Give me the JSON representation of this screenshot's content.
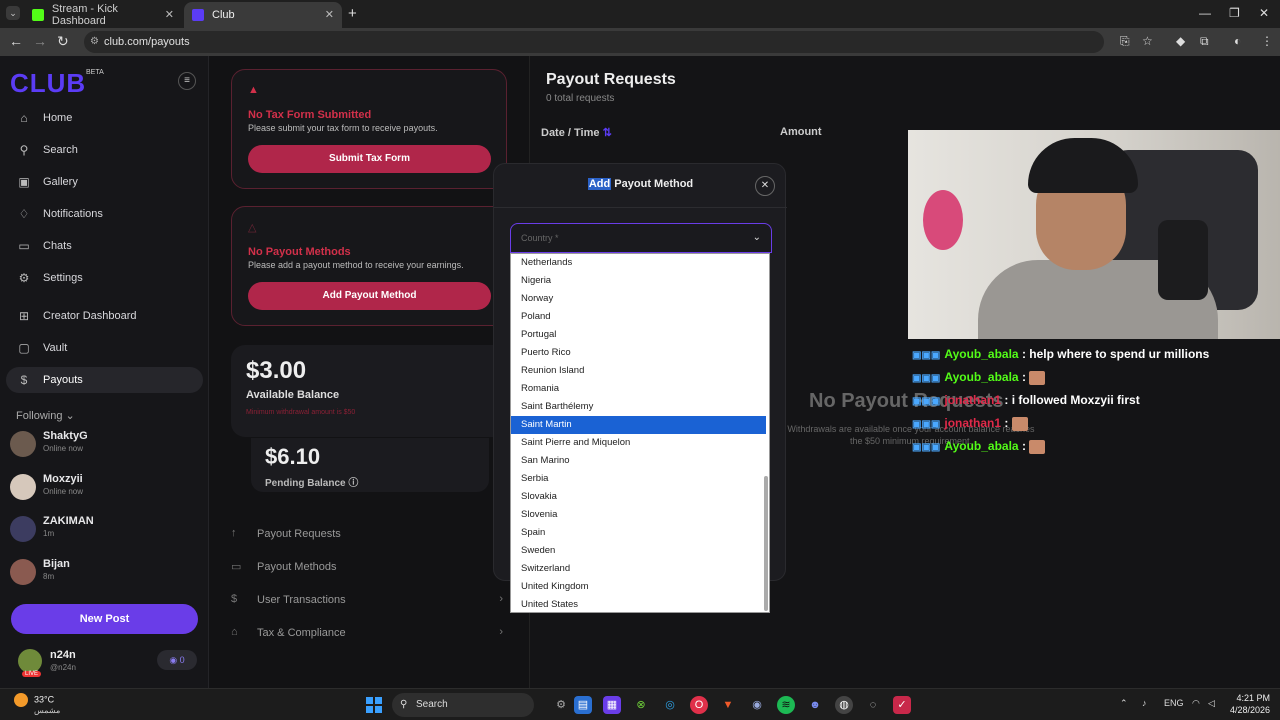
{
  "browser": {
    "tabs": [
      {
        "label": "Stream - Kick Dashboard"
      },
      {
        "label": "Club"
      }
    ],
    "url": "club.com/payouts"
  },
  "sidebar": {
    "logo": "CLUB",
    "logo_badge": "BETA",
    "nav": [
      {
        "label": "Home",
        "icon": "home-icon"
      },
      {
        "label": "Search",
        "icon": "search-icon"
      },
      {
        "label": "Gallery",
        "icon": "gallery-icon"
      },
      {
        "label": "Notifications",
        "icon": "bell-icon"
      },
      {
        "label": "Chats",
        "icon": "chat-icon"
      },
      {
        "label": "Settings",
        "icon": "gear-icon"
      },
      {
        "label": "Creator Dashboard",
        "icon": "dashboard-icon"
      },
      {
        "label": "Vault",
        "icon": "vault-icon"
      },
      {
        "label": "Payouts",
        "icon": "dollar-icon"
      }
    ],
    "following_label": "Following",
    "following": [
      {
        "name": "ShaktyG",
        "status": "Online now"
      },
      {
        "name": "Moxzyii",
        "status": "Online now"
      },
      {
        "name": "ZAKIMAN",
        "status": "1m"
      },
      {
        "name": "Bijan",
        "status": "8m"
      }
    ],
    "new_post": "New Post",
    "user": {
      "name": "n24n",
      "handle": "@n24n",
      "live": "LIVE",
      "coins": "0"
    }
  },
  "payouts": {
    "tax_card": {
      "title": "No Tax Form Submitted",
      "desc": "Please submit your tax form to receive payouts.",
      "button": "Submit Tax Form"
    },
    "method_card": {
      "title": "No Payout Methods",
      "desc": "Please add a payout method to receive your earnings.",
      "button": "Add Payout Method"
    },
    "available": {
      "amount": "$3.00",
      "label": "Available Balance",
      "note": "Minimum withdrawal amount is $50"
    },
    "pending": {
      "amount": "$6.10",
      "label": "Pending Balance"
    },
    "sub_nav": [
      {
        "label": "Payout Requests"
      },
      {
        "label": "Payout Methods"
      },
      {
        "label": "User Transactions"
      },
      {
        "label": "Tax & Compliance"
      }
    ]
  },
  "requests": {
    "title": "Payout Requests",
    "count": "0 total requests",
    "columns": {
      "date": "Date / Time",
      "amount": "Amount"
    },
    "empty_title": "No Payout Requests",
    "empty_desc": "Withdrawals are available once your account balance reaches the $50 minimum requirement."
  },
  "modal": {
    "title_highlight": "Add",
    "title_rest": " Payout Method",
    "select_placeholder": "Country *",
    "options": [
      "Netherlands",
      "Nigeria",
      "Norway",
      "Poland",
      "Portugal",
      "Puerto Rico",
      "Reunion Island",
      "Romania",
      "Saint Barthélemy",
      "Saint Martin",
      "Saint Pierre and Miquelon",
      "San Marino",
      "Serbia",
      "Slovakia",
      "Slovenia",
      "Spain",
      "Sweden",
      "Switzerland",
      "United Kingdom",
      "United States"
    ],
    "selected_option": "Saint Martin"
  },
  "chat": [
    {
      "user": "Ayoub_abala",
      "msg": " : help where to spend ur millions",
      "emote": false,
      "color": "#53fc18"
    },
    {
      "user": "Ayoub_abala",
      "msg": " : ",
      "emote": true,
      "color": "#53fc18"
    },
    {
      "user": "jonathan1",
      "msg": " : i followed Moxzyii first",
      "emote": false,
      "color": "#e02a4a"
    },
    {
      "user": "jonathan1",
      "msg": " : ",
      "emote": true,
      "color": "#e02a4a"
    },
    {
      "user": "Ayoub_abala",
      "msg": " : ",
      "emote": true,
      "color": "#53fc18"
    }
  ],
  "taskbar": {
    "weather_temp": "33°C",
    "weather_desc": "مشمس",
    "search": "Search",
    "lang": "ENG",
    "time": "4:21 PM",
    "date": "4/28/2026"
  },
  "colors": {
    "accent": "#6a3de8",
    "danger": "#d2304a",
    "selected": "#1a62d4",
    "chat_green": "#53fc18"
  }
}
